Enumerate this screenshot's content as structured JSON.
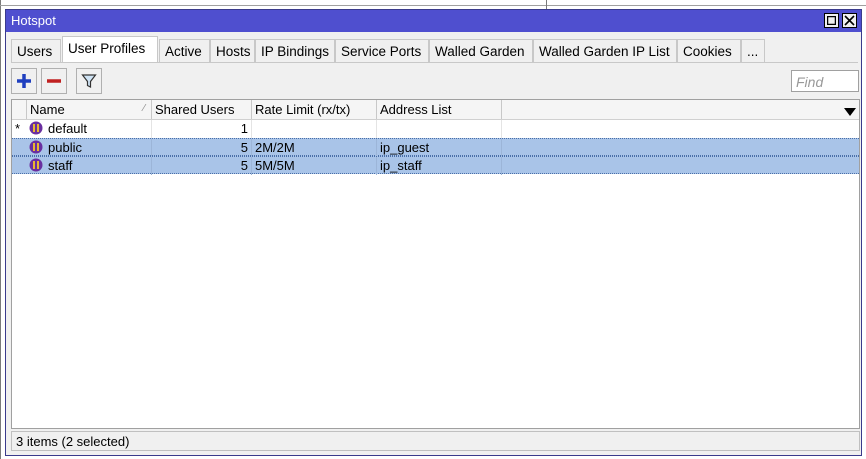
{
  "window": {
    "title": "Hotspot"
  },
  "tabs": [
    {
      "label": "Users"
    },
    {
      "label": "User Profiles",
      "active": true
    },
    {
      "label": "Active"
    },
    {
      "label": "Hosts"
    },
    {
      "label": "IP Bindings"
    },
    {
      "label": "Service Ports"
    },
    {
      "label": "Walled Garden"
    },
    {
      "label": "Walled Garden IP List"
    },
    {
      "label": "Cookies"
    },
    {
      "label": "..."
    }
  ],
  "toolbar": {
    "add_icon": "plus-icon",
    "remove_icon": "minus-icon",
    "filter_icon": "filter-icon",
    "find_placeholder": "Find"
  },
  "columns": {
    "name": "Name",
    "shared_users": "Shared Users",
    "rate_limit": "Rate Limit (rx/tx)",
    "address_list": "Address List"
  },
  "rows": [
    {
      "flag": "*",
      "name": "default",
      "shared_users": "1",
      "rate_limit": "",
      "address_list": "",
      "selected": false
    },
    {
      "flag": "",
      "name": "public",
      "shared_users": "5",
      "rate_limit": "2M/2M",
      "address_list": "ip_guest",
      "selected": true
    },
    {
      "flag": "",
      "name": "staff",
      "shared_users": "5",
      "rate_limit": "5M/5M",
      "address_list": "ip_staff",
      "selected": true
    }
  ],
  "status": {
    "text": "3 items (2 selected)"
  },
  "colors": {
    "titlebar": "#4f4fcf",
    "selection": "#a9c4e8",
    "add": "#1f3fbf",
    "remove": "#c02020"
  }
}
